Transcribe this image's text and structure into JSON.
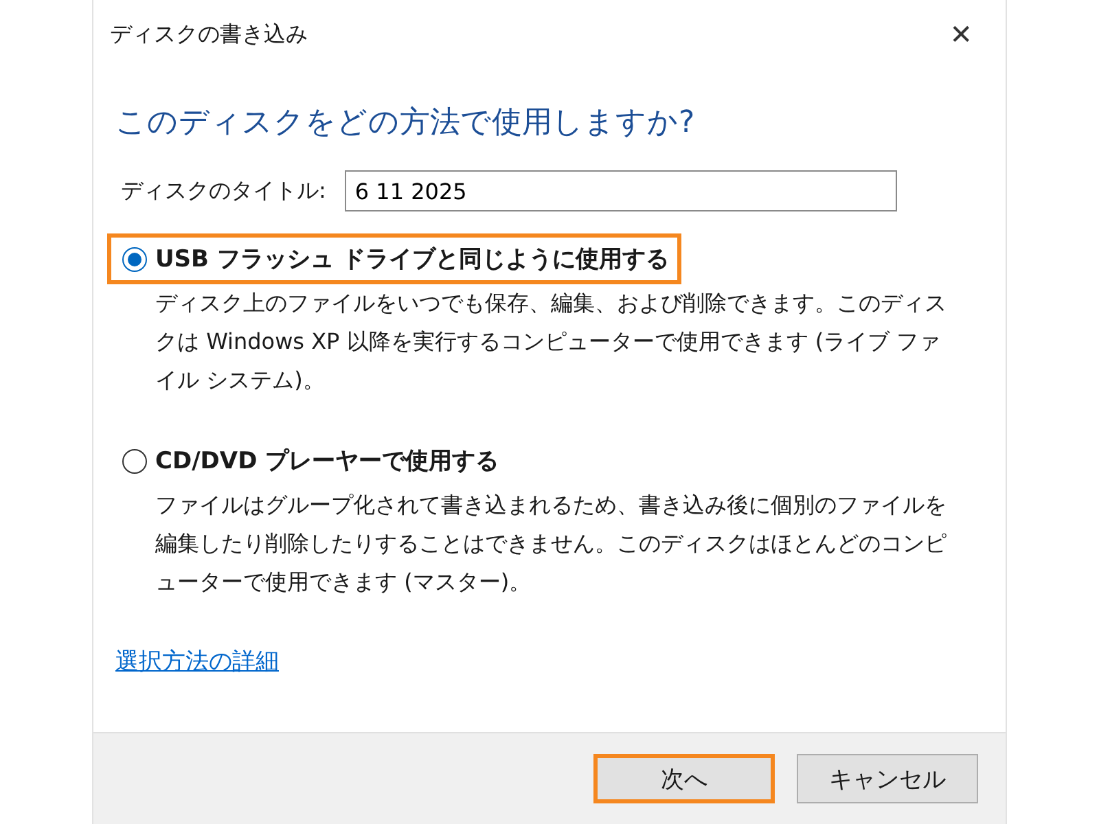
{
  "window": {
    "title": "ディスクの書き込み",
    "close": "✕"
  },
  "heading": "このディスクをどの方法で使用しますか?",
  "disc_title": {
    "label": "ディスクのタイトル:",
    "value": "6 11 2025"
  },
  "options": [
    {
      "label": "USB フラッシュ ドライブと同じように使用する",
      "description": "ディスク上のファイルをいつでも保存、編集、および削除できます。このディスクは Windows XP 以降を実行するコンピューターで使用できます (ライブ ファイル システム)。",
      "selected": true,
      "highlighted": true
    },
    {
      "label": "CD/DVD プレーヤーで使用する",
      "description": "ファイルはグループ化されて書き込まれるため、書き込み後に個別のファイルを編集したり削除したりすることはできません。このディスクはほとんどのコンピューターで使用できます (マスター)。",
      "selected": false,
      "highlighted": false
    }
  ],
  "link": "選択方法の詳細",
  "buttons": [
    {
      "label": "次へ",
      "highlighted": true
    },
    {
      "label": "キャンセル",
      "highlighted": false
    }
  ]
}
